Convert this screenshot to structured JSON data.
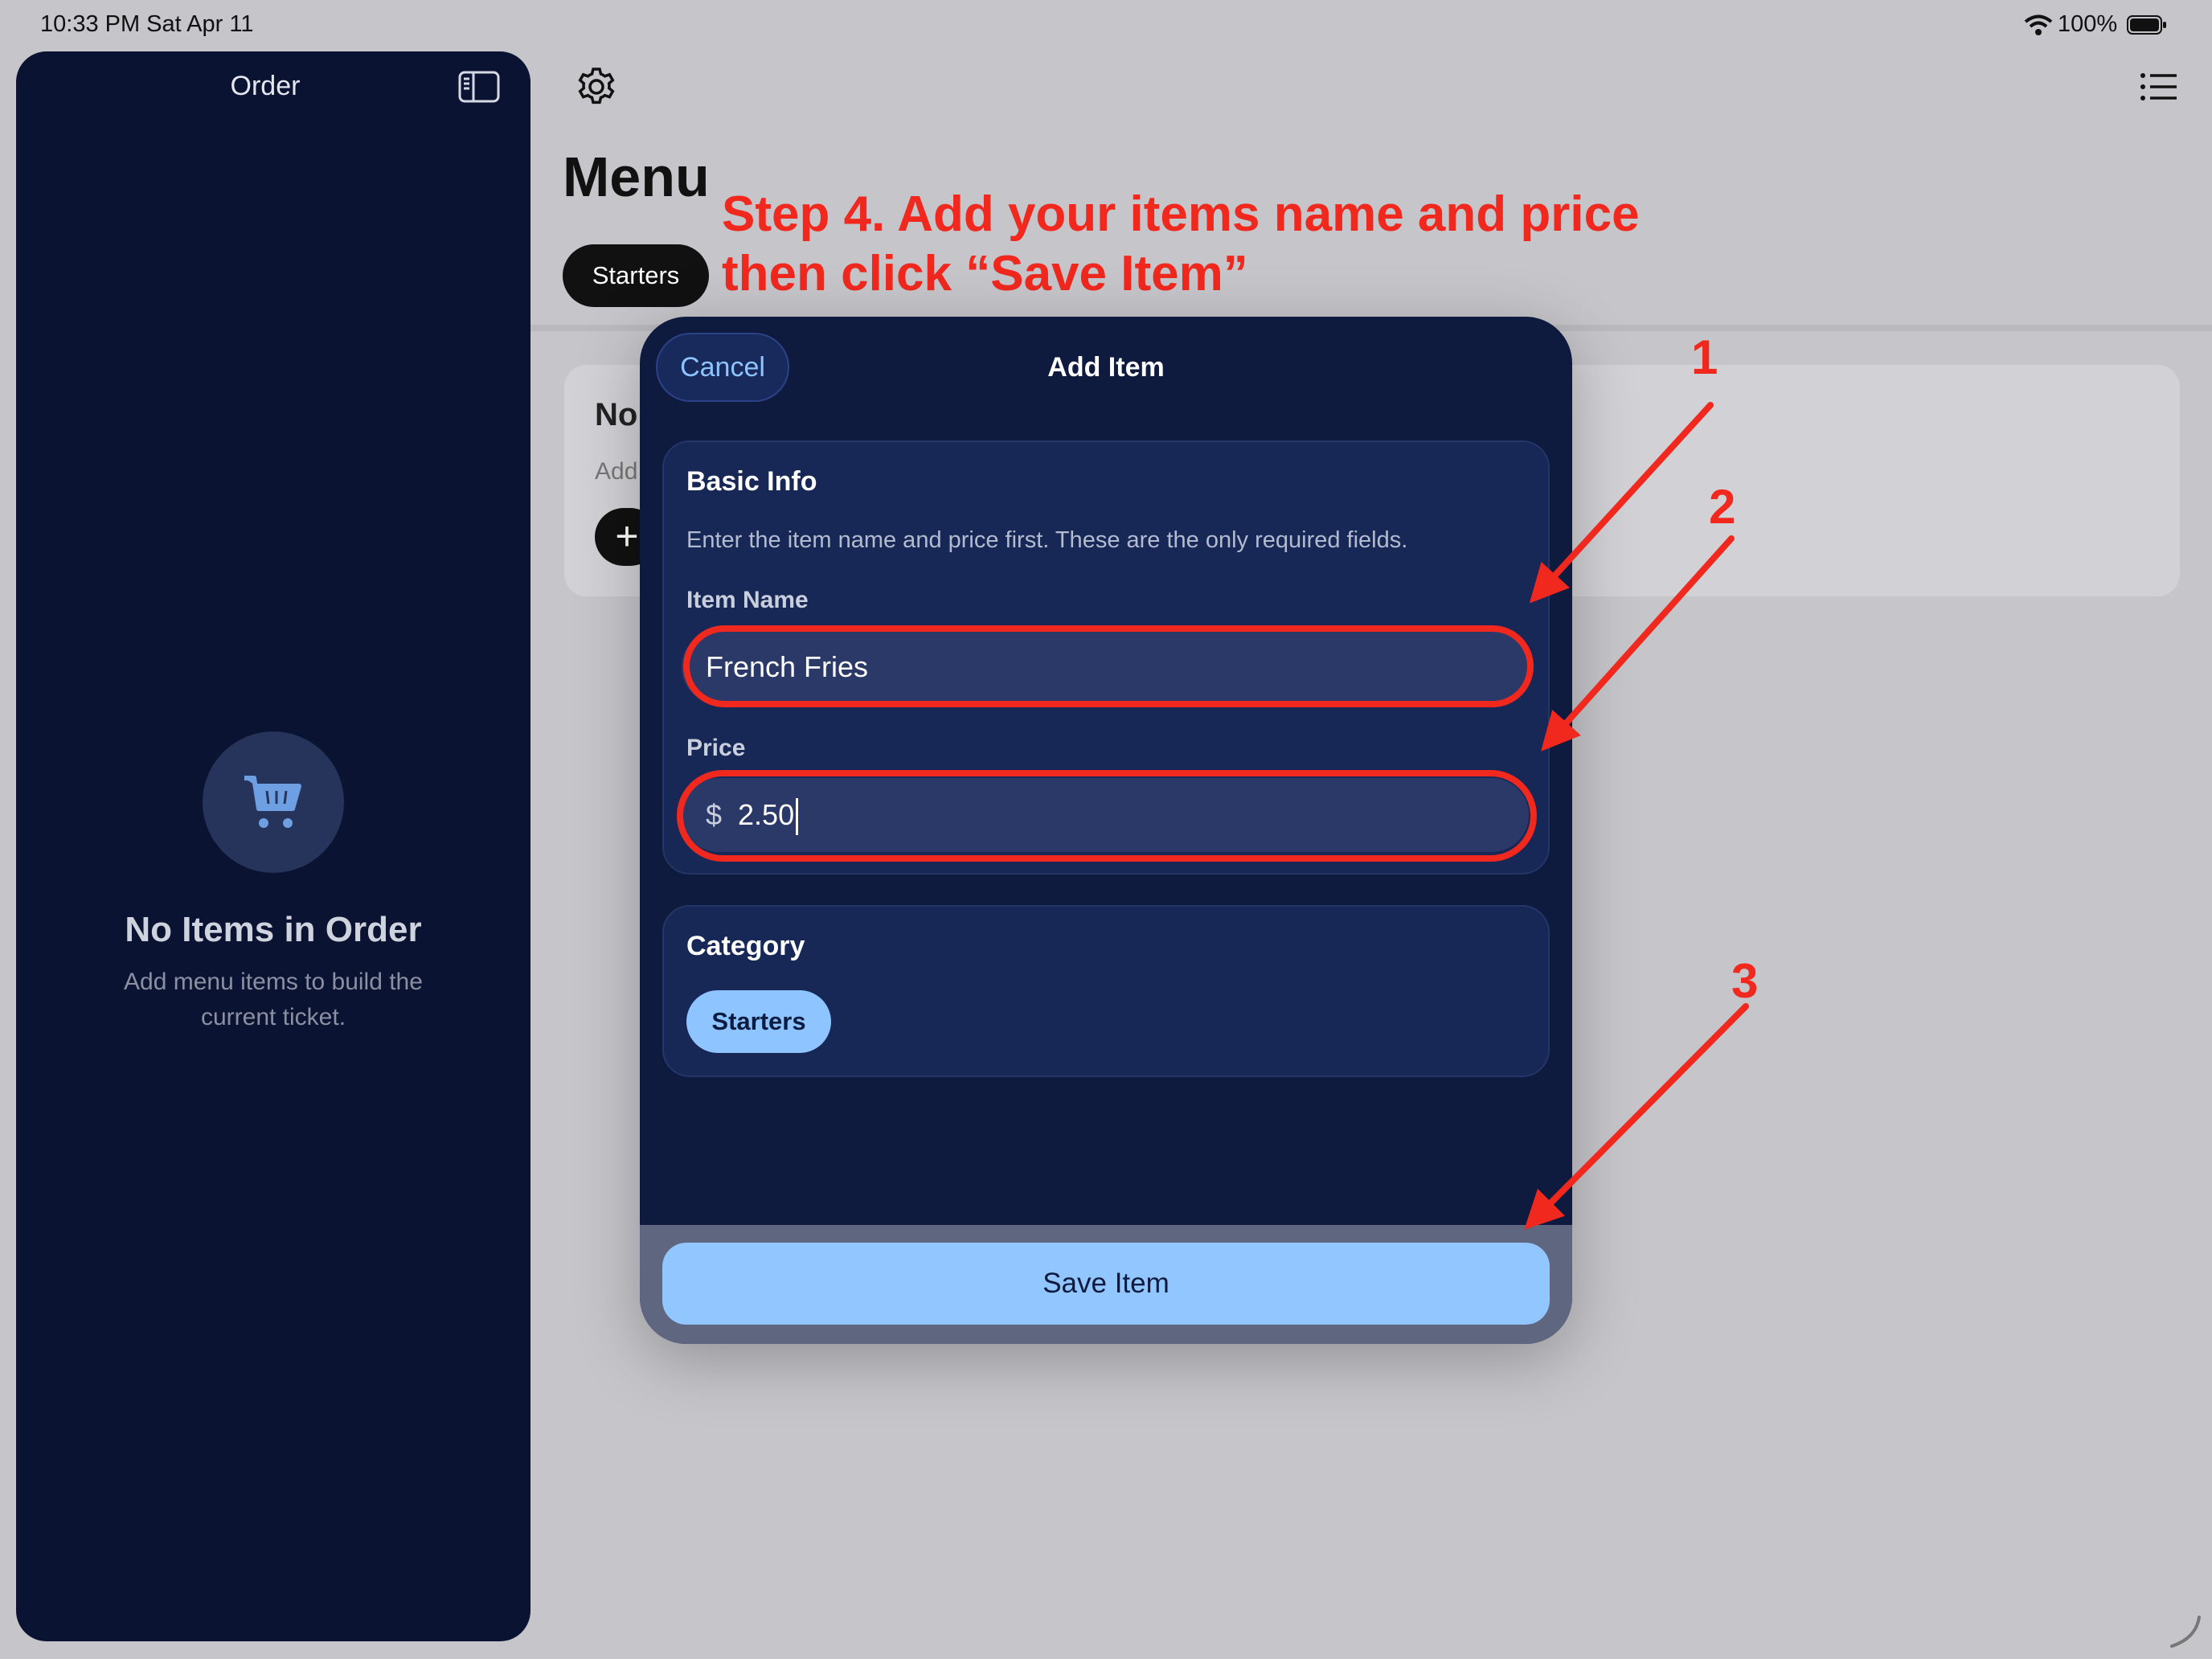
{
  "status_bar": {
    "time_date": "10:33 PM   Sat Apr 11",
    "battery_percent": "100%"
  },
  "sidebar": {
    "title": "Order",
    "empty_title": "No Items in Order",
    "empty_subtitle": "Add menu items to build the current ticket."
  },
  "main": {
    "title": "Menu",
    "category_chip": "Starters",
    "empty_card_title": "No",
    "empty_card_subtitle": "Add",
    "add_symbol": "+"
  },
  "instruction": "Step 4. Add your items name and price then click “Save Item”",
  "annotations": {
    "arrow_1": "1",
    "arrow_2": "2",
    "arrow_3": "3",
    "color": "#f0281e"
  },
  "modal": {
    "title": "Add Item",
    "cancel_label": "Cancel",
    "basic_info": {
      "heading": "Basic Info",
      "description": "Enter the item name and price first. These are the only required fields.",
      "item_name_label": "Item Name",
      "item_name_value": "French Fries",
      "price_label": "Price",
      "currency_symbol": "$",
      "price_value": "2.50"
    },
    "category": {
      "heading": "Category",
      "selected": "Starters"
    },
    "save_label": "Save Item"
  },
  "colors": {
    "sidebar_bg": "#0b1332",
    "modal_bg": "#0e1a3e",
    "accent": "#8ec4ff",
    "save_button": "#91c6ff"
  }
}
